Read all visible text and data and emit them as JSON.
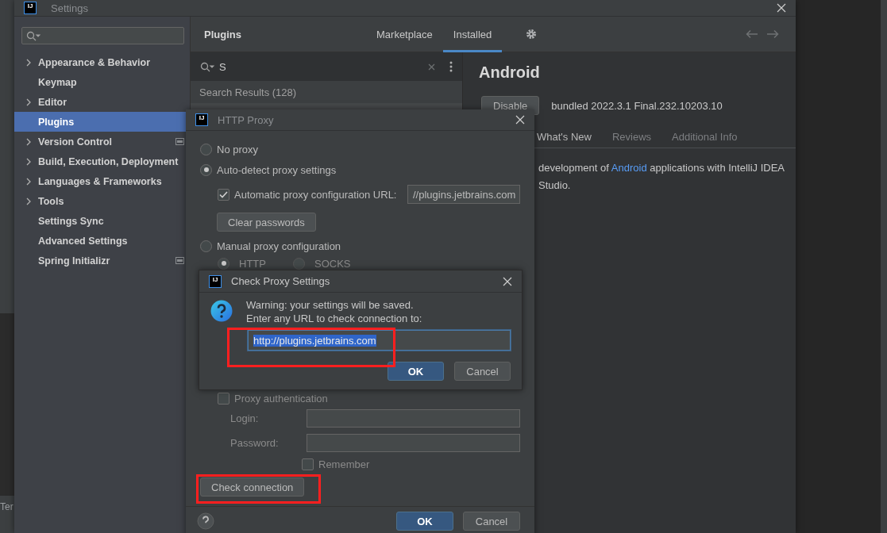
{
  "background": {
    "status_text": "Ter"
  },
  "settings": {
    "logo": "IJ",
    "title": "Settings",
    "sidebar": {
      "items": [
        {
          "label": "Appearance & Behavior",
          "expandable": true,
          "selected": false,
          "project_scoped": false
        },
        {
          "label": "Keymap",
          "expandable": false,
          "selected": false,
          "project_scoped": false
        },
        {
          "label": "Editor",
          "expandable": true,
          "selected": false,
          "project_scoped": false
        },
        {
          "label": "Plugins",
          "expandable": false,
          "selected": true,
          "project_scoped": false
        },
        {
          "label": "Version Control",
          "expandable": true,
          "selected": false,
          "project_scoped": true
        },
        {
          "label": "Build, Execution, Deployment",
          "expandable": true,
          "selected": false,
          "project_scoped": false
        },
        {
          "label": "Languages & Frameworks",
          "expandable": true,
          "selected": false,
          "project_scoped": false
        },
        {
          "label": "Tools",
          "expandable": true,
          "selected": false,
          "project_scoped": false
        },
        {
          "label": "Settings Sync",
          "expandable": false,
          "selected": false,
          "project_scoped": false
        },
        {
          "label": "Advanced Settings",
          "expandable": false,
          "selected": false,
          "project_scoped": false
        },
        {
          "label": "Spring Initializr",
          "expandable": false,
          "selected": false,
          "project_scoped": true
        }
      ]
    },
    "plugins": {
      "title": "Plugins",
      "tabs": [
        {
          "label": "Marketplace",
          "selected": false
        },
        {
          "label": "Installed",
          "selected": true
        }
      ],
      "search": {
        "value": "S"
      },
      "results_header": "Search Results (128)"
    },
    "detail": {
      "name": "Android",
      "action_button": "Disable",
      "version": "bundled 2022.3.1 Final.232.10203.10",
      "tabs": [
        {
          "label": "What's New",
          "disabled": false
        },
        {
          "label": "Reviews",
          "disabled": true
        },
        {
          "label": "Additional Info",
          "disabled": true
        }
      ],
      "description": {
        "before": "development of ",
        "link": "Android",
        "after": " applications with IntelliJ IDEA",
        "line_2": "Studio."
      }
    }
  },
  "http_proxy": {
    "logo": "IJ",
    "title": "HTTP Proxy",
    "modes": [
      {
        "label": "No proxy",
        "selected": false
      },
      {
        "label": "Auto-detect proxy settings",
        "selected": true
      },
      {
        "label": "Manual proxy configuration",
        "selected": false
      }
    ],
    "auto_config": {
      "label": "Automatic proxy configuration URL:",
      "checked": true,
      "value": "//plugins.jetbrains.com"
    },
    "clear_passwords": "Clear passwords",
    "protocols": [
      {
        "label": "HTTP",
        "selected": true
      },
      {
        "label": "SOCKS",
        "selected": false
      }
    ],
    "auth": {
      "label": "Proxy authentication",
      "checked": false
    },
    "login_label": "Login:",
    "password_label": "Password:",
    "remember": {
      "label": "Remember",
      "checked": false
    },
    "check_button": {
      "label": "Check connection",
      "annotated": true
    },
    "buttons": [
      {
        "label": "OK",
        "default": true
      },
      {
        "label": "Cancel",
        "default": false
      }
    ]
  },
  "check_proxy": {
    "logo": "IJ",
    "title": "Check Proxy Settings",
    "message": "Warning: your settings will be saved.",
    "prompt": "Enter any URL to check connection to:",
    "url": {
      "value": "http://plugins.jetbrains.com",
      "highlighted": true,
      "annotated": true
    },
    "buttons": [
      {
        "label": "OK",
        "default": true
      },
      {
        "label": "Cancel",
        "default": false
      }
    ]
  }
}
